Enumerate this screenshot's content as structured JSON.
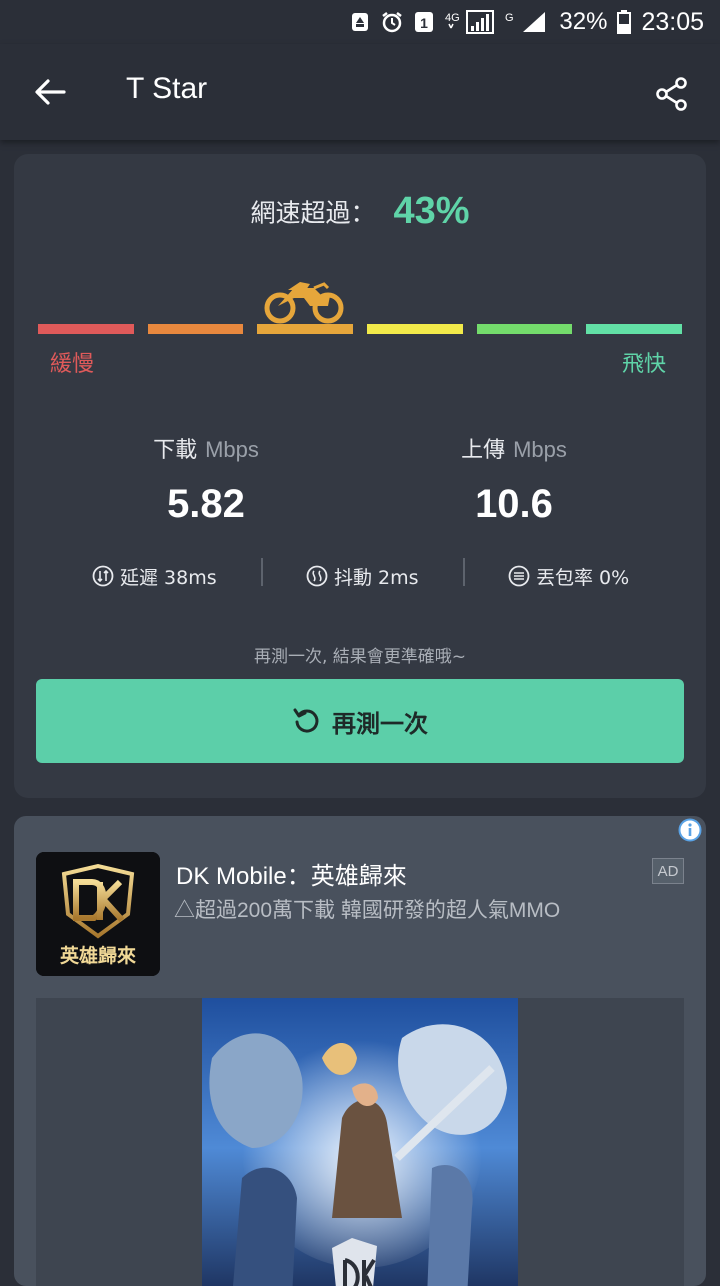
{
  "status_bar": {
    "battery": "32%",
    "time": "23:05",
    "sim_badge": "1",
    "network_4g": "4G",
    "network_g": "G"
  },
  "app_bar": {
    "title": "T Star"
  },
  "result": {
    "speed_label": "網速超過：",
    "speed_percent": "43%",
    "speed_level_fraction": 0.43,
    "slow_label": "緩慢",
    "fast_label": "飛快",
    "scale_colors": [
      "#e05a5a",
      "#e8883e",
      "#e6a63b",
      "#f2ea4a",
      "#74dc6c",
      "#62e0a6"
    ],
    "download": {
      "label": "下載",
      "unit": "Mbps",
      "value": "5.82"
    },
    "upload": {
      "label": "上傳",
      "unit": "Mbps",
      "value": "10.6"
    },
    "latency": "延遲 38ms",
    "jitter": "抖動 2ms",
    "packet_loss": "丟包率 0%",
    "hint": "再測一次, 結果會更準確哦~",
    "retest_label": "再測一次"
  },
  "ad": {
    "title": "DK Mobile：英雄歸來",
    "subtitle": "△超過200萬下載 韓國研發的超人氣MMO",
    "badge": "AD",
    "logo_text": "英雄歸來"
  },
  "colors": {
    "accent": "#5ccfa9",
    "background": "#2b2f38",
    "card": "#343943",
    "ad_card": "#49515d"
  }
}
